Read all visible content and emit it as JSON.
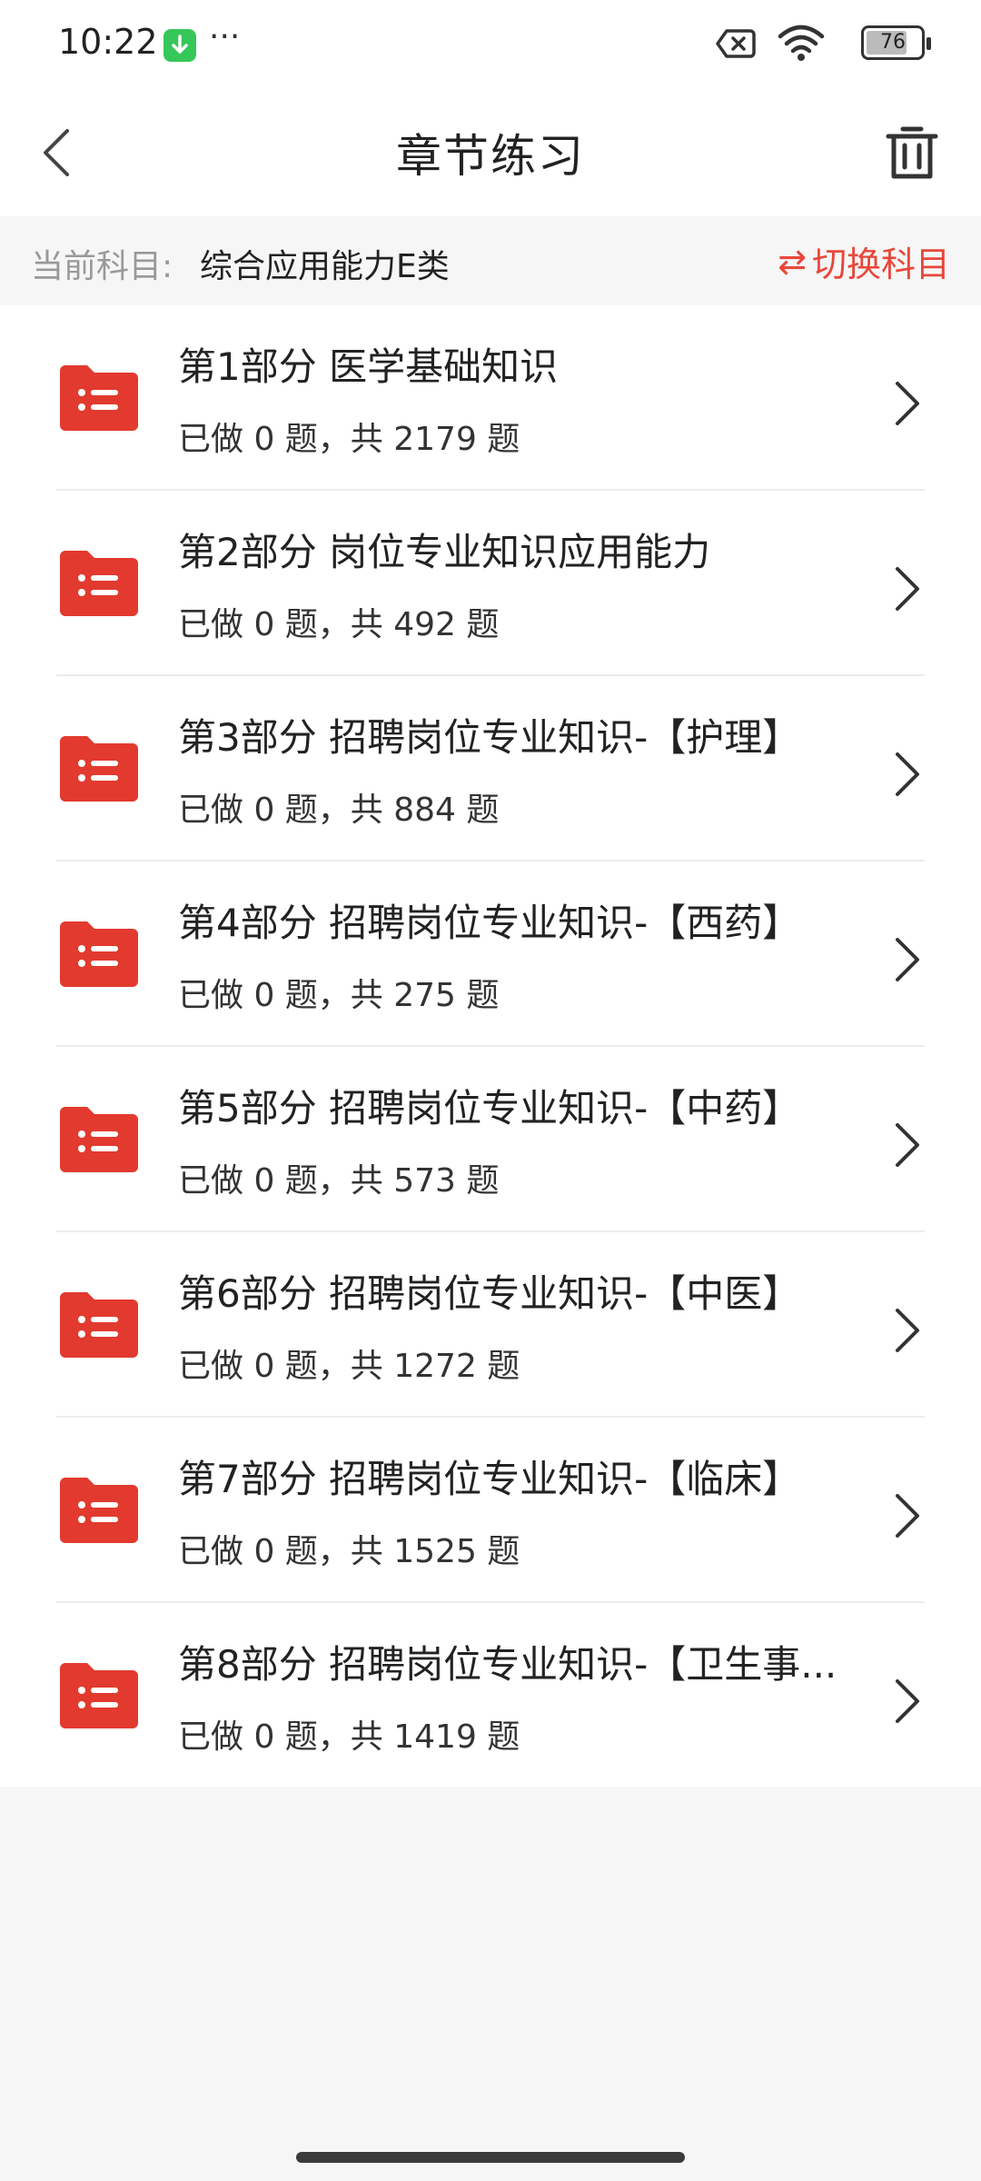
{
  "status_bar": {
    "time": "10:22",
    "dots": "···",
    "battery": "76",
    "battery_level": 0.76
  },
  "header": {
    "title": "章节练习"
  },
  "subject": {
    "label": "当前科目:",
    "value": "综合应用能力E类",
    "switch_arrows": "⇄",
    "switch_label": "切换科目"
  },
  "chapters": [
    {
      "title": "第1部分 医学基础知识",
      "progress": "已做 0 题，共 2179 题"
    },
    {
      "title": "第2部分 岗位专业知识应用能力",
      "progress": "已做 0 题，共 492 题"
    },
    {
      "title": "第3部分 招聘岗位专业知识-【护理】",
      "progress": "已做 0 题，共 884 题"
    },
    {
      "title": "第4部分 招聘岗位专业知识-【西药】",
      "progress": "已做 0 题，共 275 题"
    },
    {
      "title": "第5部分 招聘岗位专业知识-【中药】",
      "progress": "已做 0 题，共 573 题"
    },
    {
      "title": "第6部分 招聘岗位专业知识-【中医】",
      "progress": "已做 0 题，共 1272 题"
    },
    {
      "title": "第7部分 招聘岗位专业知识-【临床】",
      "progress": "已做 0 题，共 1525 题"
    },
    {
      "title": "第8部分 招聘岗位专业知识-【卫生事...",
      "progress": "已做 0 题，共 1419 题"
    }
  ],
  "colors": {
    "accent": "#e8473b",
    "folder": "#e23a2e"
  }
}
